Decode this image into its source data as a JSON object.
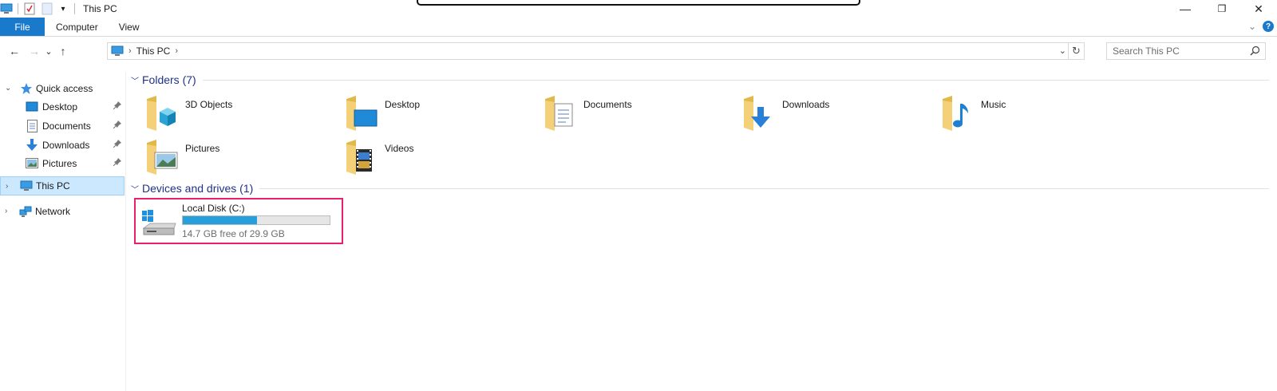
{
  "window": {
    "title": "This PC",
    "controls": {
      "minimize": "—",
      "restore": "❐",
      "close": "✕"
    }
  },
  "ribbon": {
    "tabs": [
      "File",
      "Computer",
      "View"
    ],
    "collapse_glyph": "⌄",
    "help_glyph": "?"
  },
  "nav": {
    "back": "←",
    "forward": "→",
    "recent": "⌄",
    "up": "↑",
    "address": {
      "separator": "›",
      "location": "This PC",
      "trailing": "›"
    },
    "refresh": "↻",
    "dropdown": "⌄",
    "search_placeholder": "Search This PC"
  },
  "sidebar": {
    "quick_access": {
      "label": "Quick access",
      "expander": "⌄"
    },
    "pinned": [
      {
        "label": "Desktop",
        "icon": "desktop-icon"
      },
      {
        "label": "Documents",
        "icon": "documents-icon"
      },
      {
        "label": "Downloads",
        "icon": "downloads-icon"
      },
      {
        "label": "Pictures",
        "icon": "pictures-icon"
      }
    ],
    "pin_glyph": "📌",
    "this_pc": {
      "label": "This PC",
      "expander": "›"
    },
    "network": {
      "label": "Network",
      "expander": "›"
    }
  },
  "content": {
    "folders_header": "Folders (7)",
    "folders": [
      {
        "label": "3D Objects",
        "icon": "3d-objects-icon"
      },
      {
        "label": "Desktop",
        "icon": "desktop-icon"
      },
      {
        "label": "Documents",
        "icon": "documents-icon"
      },
      {
        "label": "Downloads",
        "icon": "downloads-icon"
      },
      {
        "label": "Music",
        "icon": "music-icon"
      },
      {
        "label": "Pictures",
        "icon": "pictures-icon"
      },
      {
        "label": "Videos",
        "icon": "videos-icon"
      }
    ],
    "devices_header": "Devices and drives (1)",
    "drive": {
      "name": "Local Disk (C:)",
      "free_text": "14.7 GB free of 29.9 GB",
      "used_fraction": 0.508
    }
  },
  "colors": {
    "accent": "#1979ca",
    "group_header": "#1e3287",
    "selection_bg": "#cce8ff",
    "drive_bar": "#26a0da",
    "highlight_border": "#e8206f"
  }
}
